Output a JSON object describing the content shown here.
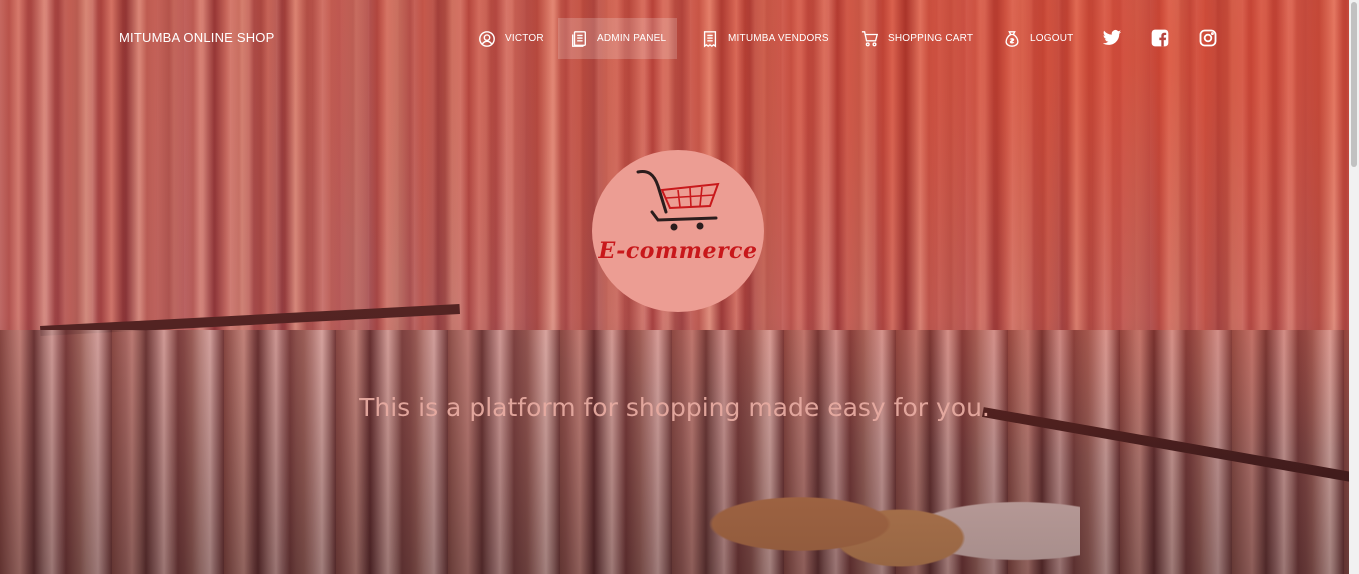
{
  "navbar": {
    "brand": "MITUMBA ONLINE SHOP",
    "items": [
      {
        "label": "VICTOR",
        "icon": "user-circle-icon"
      },
      {
        "label": "ADMIN PANEL",
        "icon": "document-list-icon",
        "active": true
      },
      {
        "label": "MITUMBA VENDORS",
        "icon": "document-icon"
      },
      {
        "label": "SHOPPING CART",
        "icon": "shopping-cart-icon"
      },
      {
        "label": "LOGOUT",
        "icon": "money-bag-icon"
      }
    ],
    "social": [
      "twitter-icon",
      "facebook-icon",
      "instagram-icon"
    ]
  },
  "hero": {
    "logo_text": "E-commerce",
    "tagline": "This is a platform for shopping made easy for you."
  },
  "colors": {
    "logo_bg": "#ec9d93",
    "logo_text": "#c8181b",
    "nav_text": "#ffffff"
  }
}
